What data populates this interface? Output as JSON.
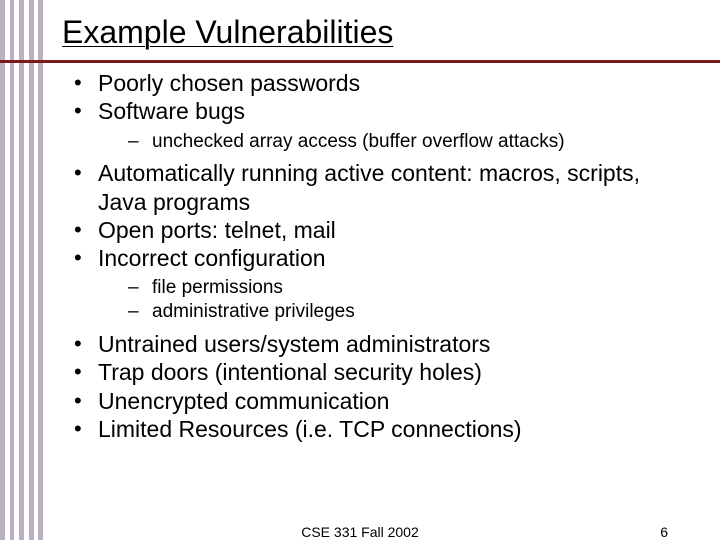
{
  "title": "Example Vulnerabilities",
  "bullets": {
    "b1": "Poorly chosen passwords",
    "b2": "Software bugs",
    "b2_1": "unchecked array access (buffer overflow attacks)",
    "b3": "Automatically running active content: macros, scripts, Java programs",
    "b4": "Open ports: telnet, mail",
    "b5": "Incorrect configuration",
    "b5_1": " file permissions",
    "b5_2": "administrative privileges",
    "b6": "Untrained users/system administrators",
    "b7": "Trap doors (intentional security holes)",
    "b8": "Unencrypted communication",
    "b9": "Limited Resources (i.e. TCP connections)"
  },
  "footer": {
    "course": "CSE 331 Fall 2002",
    "page": "6"
  }
}
